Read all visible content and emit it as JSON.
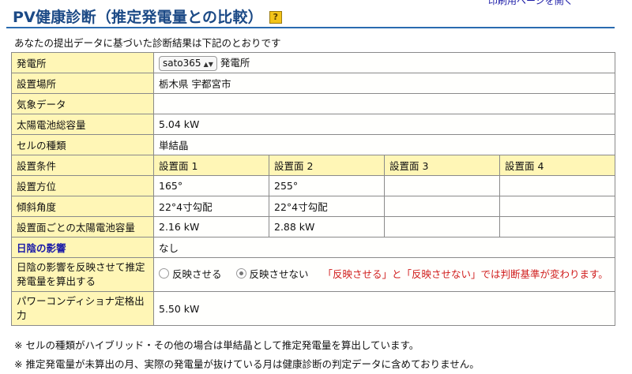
{
  "header": {
    "print_link": "印刷用ページを開く",
    "title": "PV健康診断（推定発電量との比較）",
    "help_icon": "?"
  },
  "intro": "あなたの提出データに基づいた診断結果は下記のとおりです",
  "table": {
    "plant": {
      "label": "発電所",
      "select_value": "sato365",
      "suffix": "発電所"
    },
    "location": {
      "label": "設置場所",
      "value": "栃木県 宇都宮市"
    },
    "weather": {
      "label": "気象データ",
      "value": ""
    },
    "capacity": {
      "label": "太陽電池総容量",
      "value": "5.04 kW"
    },
    "cell_type": {
      "label": "セルの種類",
      "value": "単結晶"
    },
    "conditions": {
      "label": "設置条件",
      "surfaces": [
        "設置面 1",
        "設置面 2",
        "設置面 3",
        "設置面 4"
      ]
    },
    "azimuth": {
      "label": "設置方位",
      "values": [
        "165°",
        "255°",
        "",
        ""
      ]
    },
    "tilt": {
      "label": "傾斜角度",
      "values": [
        "22°4寸勾配",
        "22°4寸勾配",
        "",
        ""
      ]
    },
    "surface_capacity": {
      "label": "設置面ごとの太陽電池容量",
      "values": [
        "2.16 kW",
        "2.88 kW",
        "",
        ""
      ]
    },
    "shadow": {
      "label": "日陰の影響",
      "value": "なし"
    },
    "reflect": {
      "label": "日陰の影響を反映させて推定発電量を算出する",
      "option_on": "反映させる",
      "option_off": "反映させない",
      "selected": "反映させない",
      "warning": "「反映させる」と「反映させない」では判断基準が変わります。"
    },
    "inverter": {
      "label": "パワーコンディショナ定格出力",
      "value": "5.50 kW"
    }
  },
  "notes": [
    "※ セルの種類がハイブリッド・その他の場合は単結晶として推定発電量を算出しています。",
    "※ 推定発電量が未算出の月、実際の発電量が抜けている月は健康診断の判定データに含めておりません。"
  ]
}
